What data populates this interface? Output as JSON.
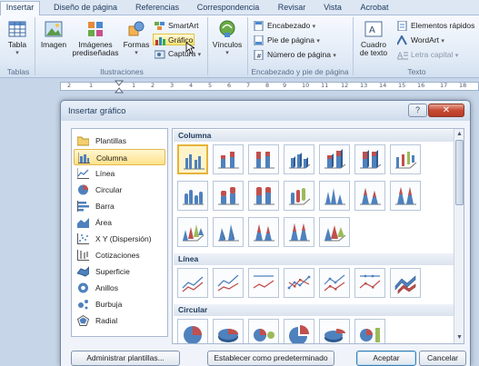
{
  "ribbon": {
    "tabs": [
      "Insertar",
      "Diseño de página",
      "Referencias",
      "Correspondencia",
      "Revisar",
      "Vista",
      "Acrobat"
    ],
    "groups": {
      "tablas": "Tablas",
      "ilustraciones": "Ilustraciones",
      "encabezado": "Encabezado y pie de página",
      "texto": "Texto"
    },
    "buttons": {
      "tabla": "Tabla",
      "imagen": "Imagen",
      "imagenes_line1": "Imágenes",
      "imagenes_line2": "prediseñadas",
      "formas": "Formas",
      "smartart": "SmartArt",
      "grafico": "Gráfico",
      "captura": "Captura",
      "vinculos": "Vínculos",
      "encabezado": "Encabezado",
      "pie": "Pie de página",
      "numero": "Número de página",
      "cuadro_line1": "Cuadro",
      "cuadro_line2": "de texto",
      "elementos": "Elementos rápidos",
      "wordart": "WordArt",
      "letra_capital": "Letra capital"
    }
  },
  "ruler": {
    "numbers": [
      "2",
      "1",
      "1",
      "2",
      "3",
      "4",
      "5",
      "6",
      "7",
      "8",
      "9",
      "10",
      "11",
      "12",
      "13",
      "14",
      "15",
      "16",
      "17",
      "18"
    ]
  },
  "dialog": {
    "title": "Insertar gráfico",
    "help": "?",
    "close": "✕",
    "categories": [
      {
        "label": "Plantillas",
        "icon": "folder-icon"
      },
      {
        "label": "Columna",
        "icon": "column-chart-icon"
      },
      {
        "label": "Línea",
        "icon": "line-chart-icon"
      },
      {
        "label": "Circular",
        "icon": "pie-chart-icon"
      },
      {
        "label": "Barra",
        "icon": "bar-chart-icon"
      },
      {
        "label": "Área",
        "icon": "area-chart-icon"
      },
      {
        "label": "X Y (Dispersión)",
        "icon": "scatter-chart-icon"
      },
      {
        "label": "Cotizaciones",
        "icon": "stock-chart-icon"
      },
      {
        "label": "Superficie",
        "icon": "surface-chart-icon"
      },
      {
        "label": "Anillos",
        "icon": "doughnut-chart-icon"
      },
      {
        "label": "Burbuja",
        "icon": "bubble-chart-icon"
      },
      {
        "label": "Radial",
        "icon": "radar-chart-icon"
      }
    ],
    "selected_category": "Columna",
    "sections": {
      "columna": "Columna",
      "linea": "Línea",
      "circular": "Circular"
    },
    "buttons": {
      "administrar": "Administrar plantillas...",
      "establecer": "Establecer como predeterminado",
      "aceptar": "Aceptar",
      "cancelar": "Cancelar"
    }
  },
  "colors": {
    "accent": "#4f81bd",
    "highlight": "#ffe476",
    "close_red": "#c74a34"
  }
}
